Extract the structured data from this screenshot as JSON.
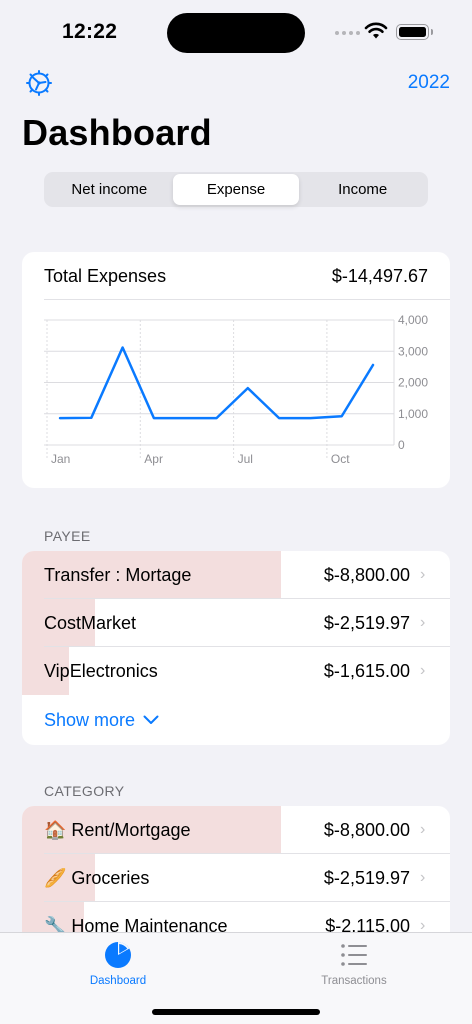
{
  "status_bar": {
    "time": "12:22"
  },
  "header": {
    "year": "2022",
    "title": "Dashboard"
  },
  "segments": [
    "Net income",
    "Expense",
    "Income"
  ],
  "selected_segment": "Expense",
  "colors": {
    "accent": "#0a7aff",
    "bar_fill": "#f3dede",
    "background": "#f2f2f7"
  },
  "chart_card": {
    "title": "Total Expenses",
    "total": "$-14,497.67"
  },
  "chart_data": {
    "type": "line",
    "x": [
      "Jan",
      "Feb",
      "Mar",
      "Apr",
      "May",
      "Jun",
      "Jul",
      "Aug",
      "Sep",
      "Oct",
      "Nov",
      "Dec"
    ],
    "x_tick_labels": [
      "Jan",
      "Apr",
      "Jul",
      "Oct"
    ],
    "y_tick_labels": [
      "4,000",
      "3,000",
      "2,000",
      "1,000",
      "0"
    ],
    "y_ticks": [
      4000,
      3000,
      2000,
      1000,
      0
    ],
    "values": [
      860,
      870,
      3120,
      860,
      860,
      860,
      1820,
      860,
      860,
      920,
      2560
    ],
    "ylim": [
      0,
      4000
    ],
    "color": "#0a7aff",
    "grid": true
  },
  "payee": {
    "label": "PAYEE",
    "rows": [
      {
        "name": "Transfer : Mortage",
        "amount": "$-8,800.00",
        "fraction": 0.605
      },
      {
        "name": "CostMarket",
        "amount": "$-2,519.97",
        "fraction": 0.17
      },
      {
        "name": "VipElectronics",
        "amount": "$-1,615.00",
        "fraction": 0.11
      }
    ],
    "show_more": "Show more"
  },
  "category": {
    "label": "CATEGORY",
    "rows": [
      {
        "name": "🏠 Rent/Mortgage",
        "amount": "$-8,800.00",
        "fraction": 0.605
      },
      {
        "name": "🥖 Groceries",
        "amount": "$-2,519.97",
        "fraction": 0.17
      },
      {
        "name": "🔧 Home Maintenance",
        "amount": "$-2,115.00",
        "fraction": 0.145
      }
    ]
  },
  "tabs": [
    {
      "label": "Dashboard",
      "icon": "pie-chart-icon",
      "active": true
    },
    {
      "label": "Transactions",
      "icon": "list-icon",
      "active": false
    }
  ]
}
